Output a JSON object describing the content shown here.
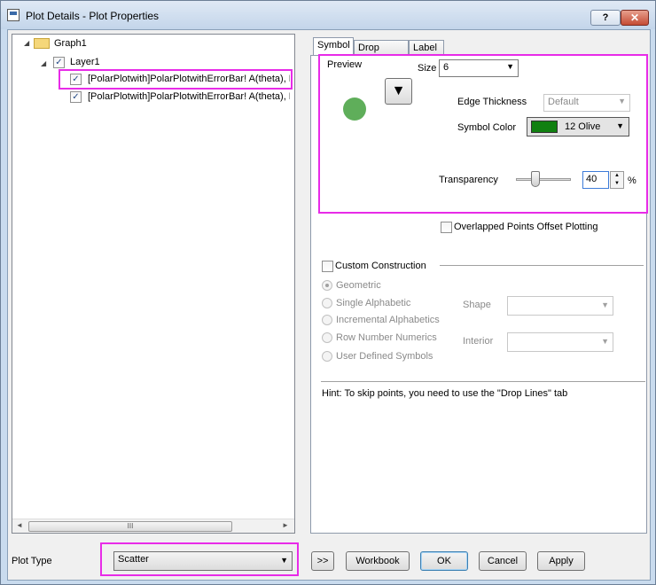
{
  "window": {
    "title": "Plot Details - Plot Properties",
    "help_label": "?",
    "close_label": "✕"
  },
  "tree": {
    "graph_label": "Graph1",
    "layer_label": "Layer1",
    "plots": [
      {
        "label": "[PolarPlotwith]PolarPlotwithErrorBar! A(theta), B(",
        "checked": true,
        "highlighted": true
      },
      {
        "label": "[PolarPlotwith]PolarPlotwithErrorBar! A(theta), B(",
        "checked": true,
        "highlighted": false
      }
    ],
    "scroll_left": "◄",
    "scroll_right": "►",
    "scroll_grip": "III"
  },
  "tabs": [
    {
      "label": "Symbol",
      "active": true
    },
    {
      "label": "Drop Lines",
      "active": false
    },
    {
      "label": "Label",
      "active": false
    }
  ],
  "symbol": {
    "preview_label": "Preview",
    "size_label": "Size",
    "size_value": "6",
    "edge_thickness_label": "Edge Thickness",
    "edge_thickness_value": "Default",
    "symbol_color_label": "Symbol Color",
    "symbol_color_value": "12 Olive",
    "symbol_color_hex": "#108010",
    "transparency_label": "Transparency",
    "transparency_value": "40",
    "transparency_unit": "%",
    "symbol_shape_glyph": "▼",
    "overlapped_label": "Overlapped Points Offset Plotting",
    "custom_construction_label": "Custom Construction",
    "radio_options": [
      "Geometric",
      "Single Alphabetic",
      "Incremental Alphabetics",
      "Row Number Numerics",
      "User Defined Symbols"
    ],
    "shape_label": "Shape",
    "interior_label": "Interior",
    "hint": "Hint: To skip points, you need to use the \"Drop Lines\" tab"
  },
  "bottom": {
    "plot_type_label": "Plot Type",
    "plot_type_value": "Scatter",
    "expand_label": ">>",
    "workbook_label": "Workbook",
    "ok_label": "OK",
    "cancel_label": "Cancel",
    "apply_label": "Apply"
  },
  "colors": {
    "highlight": "#e82be8",
    "preview_symbol": "#5fae5a"
  }
}
